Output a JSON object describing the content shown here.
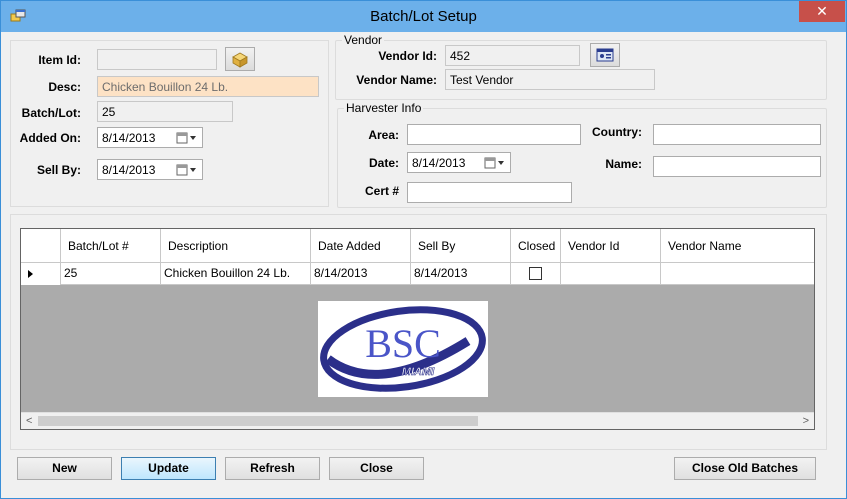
{
  "window": {
    "title": "Batch/Lot Setup",
    "close_glyph": "✕"
  },
  "item": {
    "item_id_label": "Item Id:",
    "item_id_value": "",
    "desc_label": "Desc:",
    "desc_value": "Chicken Bouillon 24 Lb.",
    "batch_label": "Batch/Lot:",
    "batch_value": "25",
    "added_on_label": "Added On:",
    "added_on_value": "8/14/2013",
    "sell_by_label": "Sell By:",
    "sell_by_value": "8/14/2013"
  },
  "vendor": {
    "group_title": "Vendor",
    "vendor_id_label": "Vendor Id:",
    "vendor_id_value": "452",
    "vendor_name_label": "Vendor Name:",
    "vendor_name_value": "Test Vendor"
  },
  "harvester": {
    "group_title": "Harvester Info",
    "area_label": "Area:",
    "area_value": "",
    "country_label": "Country:",
    "country_value": "",
    "date_label": "Date:",
    "date_value": "8/14/2013",
    "name_label": "Name:",
    "name_value": "",
    "cert_label": "Cert #",
    "cert_value": ""
  },
  "grid": {
    "columns": [
      "Batch/Lot #",
      "Description",
      "Date Added",
      "Sell By",
      "Closed",
      "Vendor Id",
      "Vendor Name"
    ],
    "rows": [
      {
        "batch": "25",
        "description": "Chicken Bouillon 24 Lb.",
        "date_added": "8/14/2013",
        "sell_by": "8/14/2013",
        "closed": false,
        "vendor_id": "",
        "vendor_name": ""
      }
    ],
    "logo_main": "BSC",
    "logo_sub": "MIAMI",
    "scroll_left_glyph": "<",
    "scroll_right_glyph": ">"
  },
  "buttons": {
    "new": "New",
    "update": "Update",
    "refresh": "Refresh",
    "close": "Close",
    "close_old_batches": "Close Old Batches"
  },
  "colors": {
    "titlebar": "#6cb0ea",
    "close_button": "#c7504a",
    "desc_highlight": "#fde2c5",
    "logo_blue": "#2b2f8a"
  }
}
